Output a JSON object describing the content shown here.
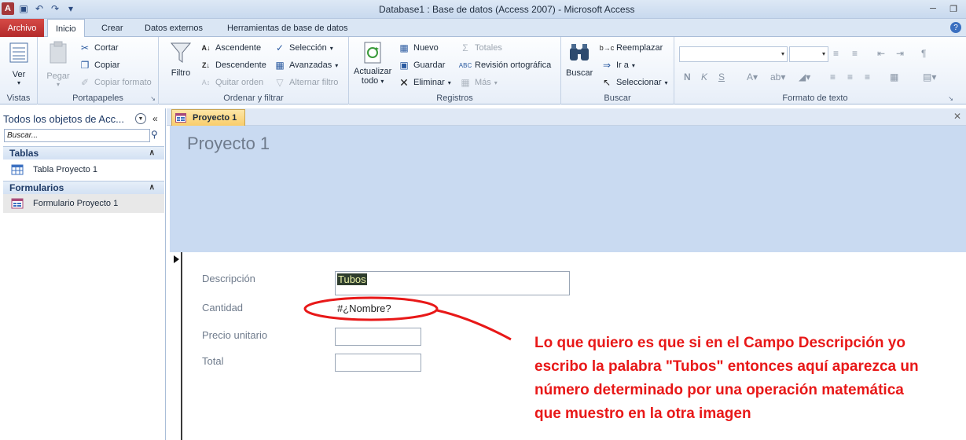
{
  "window": {
    "title": "Database1 : Base de datos (Access 2007)  -  Microsoft Access",
    "app_icon": "A"
  },
  "ribbon_tabs": {
    "archivo": "Archivo",
    "inicio": "Inicio",
    "crear": "Crear",
    "datos_externos": "Datos externos",
    "herramientas": "Herramientas de base de datos"
  },
  "groups": {
    "vistas": {
      "label": "Vistas",
      "ver": "Ver"
    },
    "portapapeles": {
      "label": "Portapapeles",
      "pegar": "Pegar",
      "cortar": "Cortar",
      "copiar": "Copiar",
      "copiar_formato": "Copiar formato"
    },
    "ordenar": {
      "label": "Ordenar y filtrar",
      "filtro": "Filtro",
      "ascendente": "Ascendente",
      "descendente": "Descendente",
      "quitar_orden": "Quitar orden",
      "seleccion": "Selección",
      "avanzadas": "Avanzadas",
      "alternar_filtro": "Alternar filtro"
    },
    "registros": {
      "label": "Registros",
      "actualizar": "Actualizar",
      "todo": "todo",
      "nuevo": "Nuevo",
      "guardar": "Guardar",
      "eliminar": "Eliminar",
      "totales": "Totales",
      "revision": "Revisión ortográfica",
      "mas": "Más"
    },
    "buscar": {
      "label": "Buscar",
      "buscar": "Buscar",
      "reemplazar": "Reemplazar",
      "ir_a": "Ir a",
      "seleccionar": "Seleccionar"
    },
    "formato": {
      "label": "Formato de texto",
      "bold": "N",
      "italic": "K",
      "underline": "S"
    }
  },
  "nav": {
    "header": "Todos los objetos de Acc...",
    "search_placeholder": "Buscar...",
    "categories": [
      {
        "name": "Tablas",
        "items": [
          "Tabla Proyecto 1"
        ]
      },
      {
        "name": "Formularios",
        "items": [
          "Formulario Proyecto 1"
        ]
      }
    ]
  },
  "document": {
    "tab": "Proyecto 1",
    "form_title": "Proyecto 1",
    "fields": {
      "descripcion": {
        "label": "Descripción",
        "value": "Tubos"
      },
      "cantidad": {
        "label": "Cantidad",
        "value": "#¿Nombre?"
      },
      "precio": {
        "label": "Precio unitario",
        "value": ""
      },
      "total": {
        "label": "Total",
        "value": ""
      }
    }
  },
  "annotation": {
    "lines": [
      "Lo que quiero es que si en el Campo Descripción yo",
      "escribo la palabra \"Tubos\" entonces aquí aparezca un",
      "número determinado por una operación matemática",
      "que muestro en la  otra imagen"
    ],
    "color": "#e81818"
  }
}
